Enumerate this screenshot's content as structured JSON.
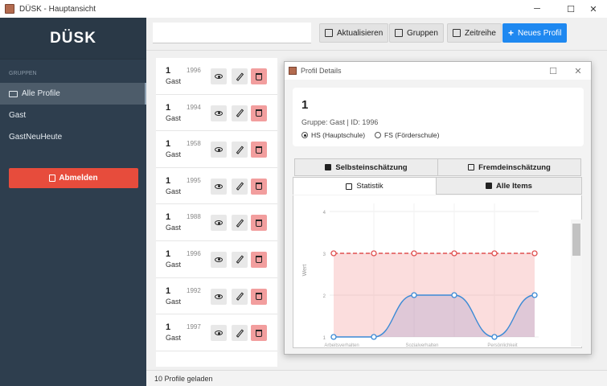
{
  "window": {
    "title": "DÜSK - Hauptansicht",
    "controls": {
      "minimize": "─",
      "maximize": "☐",
      "close": "✕"
    }
  },
  "sidebar": {
    "brand": "DÜSK",
    "group_header": "GRUPPEN",
    "items": [
      {
        "label": "Alle Profile",
        "active": true
      },
      {
        "label": "Gast",
        "active": false
      },
      {
        "label": "GastNeuHeute",
        "active": false
      }
    ],
    "logout_label": "Abmelden"
  },
  "toolbar": {
    "search_value": "",
    "refresh_label": "Aktualisieren",
    "groups_label": "Gruppen",
    "timeseries_label": "Zeitreihe",
    "new_profile_label": "Neues Profil"
  },
  "profiles": [
    {
      "id": "1",
      "group": "Gast",
      "year": "1996"
    },
    {
      "id": "1",
      "group": "Gast",
      "year": "1994"
    },
    {
      "id": "1",
      "group": "Gast",
      "year": "1958"
    },
    {
      "id": "1",
      "group": "Gast",
      "year": "1995"
    },
    {
      "id": "1",
      "group": "Gast",
      "year": "1988"
    },
    {
      "id": "1",
      "group": "Gast",
      "year": "1996"
    },
    {
      "id": "1",
      "group": "Gast",
      "year": "1992"
    },
    {
      "id": "1",
      "group": "Gast",
      "year": "1997"
    }
  ],
  "status": {
    "text": "10 Profile geladen"
  },
  "dialog": {
    "title": "Profil Details",
    "controls": {
      "maximize": "☐",
      "close": "✕"
    },
    "profile_id": "1",
    "info": "Gruppe: Gast | ID: 1996",
    "school_options": [
      {
        "label": "HS (Hauptschule)",
        "selected": true
      },
      {
        "label": "FS (Förderschule)",
        "selected": false
      }
    ],
    "tabs": {
      "self": "Selbsteinschätzung",
      "external": "Fremdeinschätzung",
      "stats": "Statistik",
      "items": "Alle Items"
    }
  },
  "colors": {
    "sidebar_bg": "#2e3e4e",
    "primary_button": "#1e88f0",
    "logout_button": "#e74c3c",
    "delete_button": "#f29e9e",
    "red_series": "#e05050",
    "blue_series": "#3a8ad6"
  },
  "chart_data": {
    "type": "line",
    "ylabel": "Wert",
    "ylim": [
      1,
      4
    ],
    "yticks": [
      "1",
      "2",
      "3",
      "4"
    ],
    "categories": [
      "Arbeitsverhalten",
      "",
      "Sozialverhalten",
      "",
      "Persönlichkeit",
      ""
    ],
    "series": [
      {
        "values": [
          3,
          3,
          3,
          3,
          3,
          3
        ],
        "style": "dashed",
        "fill": "area",
        "color": "#e05050"
      },
      {
        "values": [
          1,
          1,
          2,
          2,
          1,
          2
        ],
        "style": "smooth",
        "fill": "area",
        "color": "#3a8ad6"
      }
    ],
    "grid": true
  }
}
